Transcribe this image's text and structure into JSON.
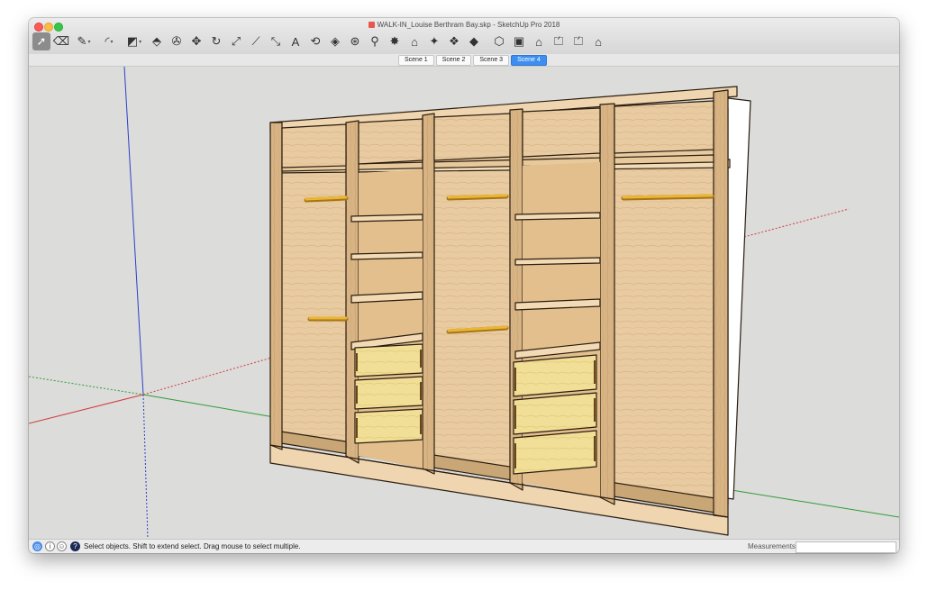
{
  "window": {
    "title": "WALK-IN_Louise Berthram Bay.skp - SketchUp Pro 2018"
  },
  "toolbar": {
    "tools": [
      {
        "name": "select-tool",
        "glyph": "➚",
        "active": true
      },
      {
        "name": "eraser-tool",
        "glyph": "⌫"
      },
      {
        "name": "line-tool",
        "glyph": "✎",
        "caret": true
      },
      {
        "name": "arc-tool",
        "glyph": "◜",
        "caret": true
      },
      {
        "name": "shape-tool",
        "glyph": "◩",
        "caret": true
      },
      {
        "name": "push-pull-tool",
        "glyph": "⬘"
      },
      {
        "name": "paint-bucket-tool",
        "glyph": "✇"
      },
      {
        "name": "move-tool",
        "glyph": "✥"
      },
      {
        "name": "rotate-tool",
        "glyph": "↻"
      },
      {
        "name": "scale-tool",
        "glyph": "⤢"
      },
      {
        "name": "tape-measure-tool",
        "glyph": "⟋"
      },
      {
        "name": "dimension-tool",
        "glyph": "⤡"
      },
      {
        "name": "text-tool",
        "glyph": "A"
      },
      {
        "name": "follow-me-tool",
        "glyph": "⟲"
      },
      {
        "name": "offset-tool",
        "glyph": "◈"
      },
      {
        "name": "orbit-tool",
        "glyph": "⊛"
      },
      {
        "name": "zoom-tool",
        "glyph": "⚲"
      },
      {
        "name": "zoom-extents-tool",
        "glyph": "✸"
      },
      {
        "name": "warehouse-tool",
        "glyph": "⌂"
      },
      {
        "name": "extension-tool",
        "glyph": "✦"
      },
      {
        "name": "model-info-tool",
        "glyph": "❖"
      },
      {
        "name": "ruby-tool",
        "glyph": "◆"
      },
      {
        "name": "iso-view-tool",
        "glyph": "⬡"
      },
      {
        "name": "top-view-tool",
        "glyph": "▣"
      },
      {
        "name": "front-view-tool",
        "glyph": "⌂"
      },
      {
        "name": "right-view-tool",
        "glyph": "⏍"
      },
      {
        "name": "back-view-tool",
        "glyph": "⏍"
      },
      {
        "name": "left-view-tool",
        "glyph": "⌂"
      }
    ]
  },
  "scenes": {
    "tabs": [
      "Scene 1",
      "Scene 2",
      "Scene 3",
      "Scene 4"
    ],
    "active": 3
  },
  "status": {
    "message": "Select objects. Shift to extend select. Drag mouse to select multiple.",
    "measurements_label": "Measurements",
    "measurements_value": ""
  },
  "colors": {
    "red_axis": "#d23b3b",
    "green_axis": "#2f9d35",
    "blue_axis": "#2d3fc9",
    "wood": "#e6c79e",
    "wood_dark": "#b98a56",
    "rail": "#e2a829",
    "drawer": "#f0dc8e",
    "accent": "#3d8ef0"
  }
}
